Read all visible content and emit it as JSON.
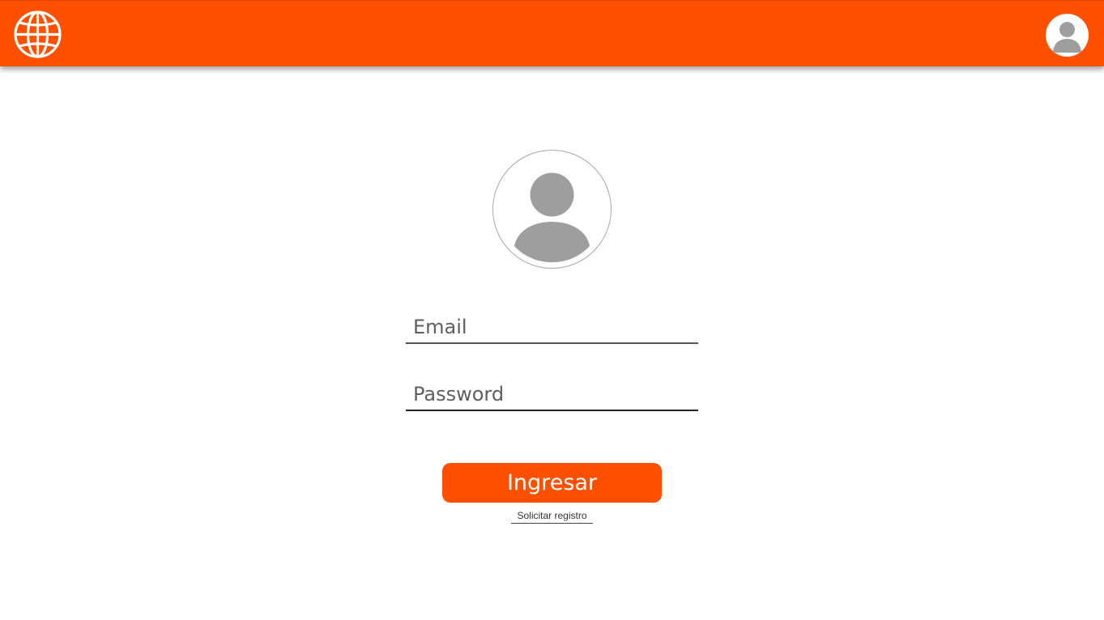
{
  "header": {
    "logo_icon": "globe-icon",
    "user_icon": "user-avatar-icon",
    "background_color": "#ff5000"
  },
  "login": {
    "avatar_icon": "user-avatar-icon",
    "email": {
      "placeholder": "Email",
      "value": ""
    },
    "password": {
      "placeholder": "Password",
      "value": ""
    },
    "submit_label": "Ingresar",
    "register_label": "Solicitar registro",
    "accent_color": "#ff5000"
  }
}
